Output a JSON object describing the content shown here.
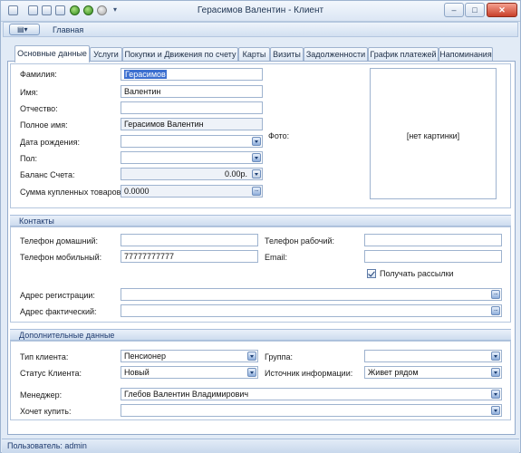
{
  "window": {
    "title": "Герасимов Валентин - Клиент",
    "min_label": "–",
    "max_label": "□",
    "close_label": "✕"
  },
  "ribbon": {
    "tab_label": "Главная"
  },
  "tabs": [
    "Основные данные",
    "Услуги",
    "Покупки и Движения по счету",
    "Карты",
    "Визиты",
    "Задолженности",
    "График платежей",
    "Напоминания"
  ],
  "main": {
    "last_name_label": "Фамилия:",
    "last_name": "Герасимов",
    "first_name_label": "Имя:",
    "first_name": "Валентин",
    "patronymic_label": "Отчество:",
    "patronymic": "",
    "full_name_label": "Полное имя:",
    "full_name": "Герасимов Валентин",
    "birth_date_label": "Дата рождения:",
    "birth_date": "",
    "gender_label": "Пол:",
    "gender": "",
    "balance_label": "Баланс Счета:",
    "balance": "0.00р.",
    "purchases_label": "Сумма купленных товаров:",
    "purchases": "0.0000",
    "photo_label": "Фото:",
    "photo_placeholder": "[нет картинки]"
  },
  "contacts": {
    "header": "Контакты",
    "home_phone_label": "Телефон домашний:",
    "home_phone": "",
    "work_phone_label": "Телефон рабочий:",
    "work_phone": "",
    "mobile_label": "Телефон мобильный:",
    "mobile": "77777777777",
    "email_label": "Email:",
    "email": "",
    "subscribe_label": "Получать рассылки",
    "subscribe": true,
    "reg_address_label": "Адрес регистрации:",
    "reg_address": "",
    "actual_address_label": "Адрес фактический:",
    "actual_address": ""
  },
  "extra": {
    "header": "Дополнительные данные",
    "client_type_label": "Тип клиента:",
    "client_type": "Пенсионер",
    "group_label": "Группа:",
    "group": "",
    "client_status_label": "Статус Клиента:",
    "client_status": "Новый",
    "info_source_label": "Источник информации:",
    "info_source": "Живет рядом",
    "manager_label": "Менеджер:",
    "manager": "Глебов Валентин Владимирович",
    "wants_to_buy_label": "Хочет купить:",
    "wants_to_buy": ""
  },
  "status": {
    "user": "Пользователь: admin"
  },
  "colors": {
    "accent": "#3b6fd0",
    "section_text": "#1e3a6e",
    "close_button": "#c8402a"
  }
}
